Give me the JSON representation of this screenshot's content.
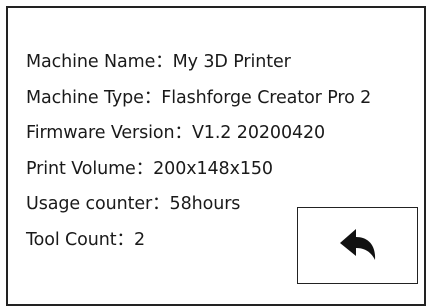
{
  "info_rows": [
    {
      "label": "Machine Name",
      "separator": "：",
      "value": "My 3D Printer"
    },
    {
      "label": "Machine Type",
      "separator": "：",
      "value": "Flashforge Creator Pro 2"
    },
    {
      "label": "Firmware Version",
      "separator": "：",
      "value": "V1.2 20200420"
    },
    {
      "label": "Print Volume",
      "separator": "：",
      "value": "200x148x150"
    },
    {
      "label": "Usage counter",
      "separator": "：",
      "value": "58hours"
    },
    {
      "label": "Tool Count",
      "separator": "：",
      "value": "2"
    }
  ],
  "back_button": {
    "icon": "back-arrow-icon"
  },
  "colors": {
    "text": "#1a1a1a",
    "border": "#222222",
    "background": "#ffffff"
  }
}
